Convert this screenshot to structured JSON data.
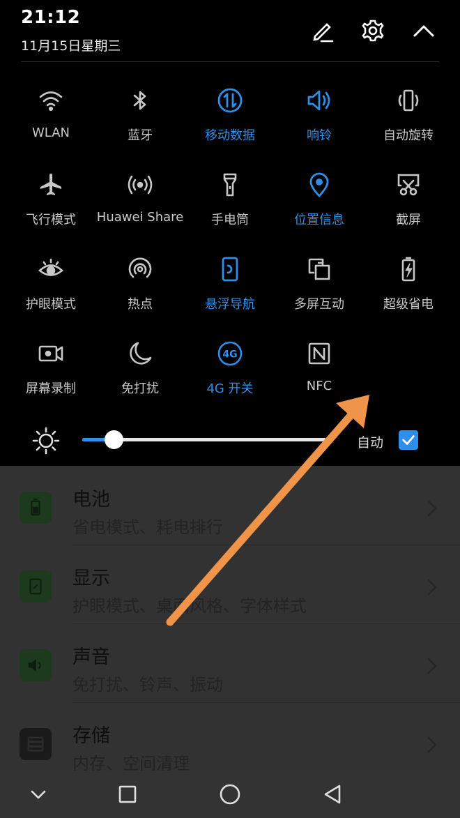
{
  "status": {
    "time": "21:12",
    "date": "11月15日星期三"
  },
  "header_icons": [
    "edit-icon",
    "settings-gear-icon",
    "collapse-chevron-up-icon"
  ],
  "accent_color": "#2f8fe8",
  "tiles": [
    {
      "label": "WLAN",
      "icon": "wifi-icon",
      "active": false
    },
    {
      "label": "蓝牙",
      "icon": "bluetooth-icon",
      "active": false
    },
    {
      "label": "移动数据",
      "icon": "mobile-data-icon",
      "active": true
    },
    {
      "label": "响铃",
      "icon": "speaker-icon",
      "active": true
    },
    {
      "label": "自动旋转",
      "icon": "auto-rotate-icon",
      "active": false
    },
    {
      "label": "飞行模式",
      "icon": "airplane-icon",
      "active": false
    },
    {
      "label": "Huawei Share",
      "icon": "huawei-share-icon",
      "active": false
    },
    {
      "label": "手电筒",
      "icon": "flashlight-icon",
      "active": false
    },
    {
      "label": "位置信息",
      "icon": "location-pin-icon",
      "active": true
    },
    {
      "label": "截屏",
      "icon": "screenshot-scissors-icon",
      "active": false
    },
    {
      "label": "护眼模式",
      "icon": "eye-icon",
      "active": false
    },
    {
      "label": "热点",
      "icon": "hotspot-icon",
      "active": false
    },
    {
      "label": "悬浮导航",
      "icon": "floating-nav-icon",
      "active": true
    },
    {
      "label": "多屏互动",
      "icon": "multi-screen-icon",
      "active": false
    },
    {
      "label": "超级省电",
      "icon": "battery-saver-icon",
      "active": false
    },
    {
      "label": "屏幕录制",
      "icon": "screen-record-icon",
      "active": false
    },
    {
      "label": "免打扰",
      "icon": "moon-icon",
      "active": false
    },
    {
      "label": "4G 开关",
      "icon": "4g-icon",
      "active": true
    },
    {
      "label": "NFC",
      "icon": "nfc-icon",
      "active": false
    }
  ],
  "brightness": {
    "level_fraction": 0.13,
    "auto_label": "自动",
    "auto_checked": true
  },
  "settings_list": [
    {
      "title": "电池",
      "subtitle": "省电模式、耗电排行",
      "icon": "battery-icon",
      "icon_color": "#1e3a1e"
    },
    {
      "title": "显示",
      "subtitle": "护眼模式、桌面风格、字体样式",
      "icon": "display-icon",
      "icon_color": "#1e3a1e"
    },
    {
      "title": "声音",
      "subtitle": "免打扰、铃声、振动",
      "icon": "sound-icon",
      "icon_color": "#1e3a1e"
    },
    {
      "title": "存储",
      "subtitle": "内存、空间清理",
      "icon": "storage-icon",
      "icon_color": "#1a1a1a"
    }
  ],
  "annotation_arrow_color": "#f0944a",
  "navbar_icons": [
    "chevron-down-icon",
    "recents-square-icon",
    "home-circle-icon",
    "back-triangle-icon"
  ]
}
